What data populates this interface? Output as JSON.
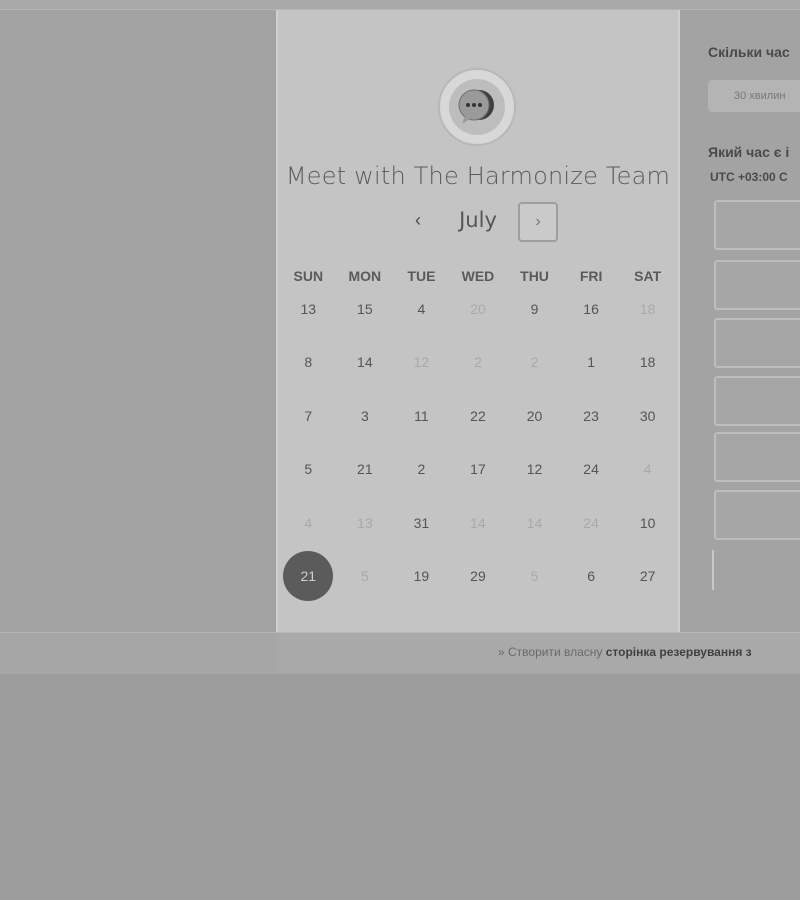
{
  "card": {
    "title": "Meet with The Harmonize Team",
    "month": "July",
    "prev_label": "‹",
    "next_label": "›"
  },
  "weekdays": [
    "SUN",
    "MON",
    "TUE",
    "WED",
    "THU",
    "FRI",
    "SAT"
  ],
  "calendar": {
    "rows": [
      [
        {
          "d": "13"
        },
        {
          "d": "15"
        },
        {
          "d": "4"
        },
        {
          "d": "20",
          "muted": true
        },
        {
          "d": "9"
        },
        {
          "d": "16"
        },
        {
          "d": "18",
          "muted": true
        }
      ],
      [
        {
          "d": "8"
        },
        {
          "d": "14"
        },
        {
          "d": "12",
          "muted": true
        },
        {
          "d": "2",
          "muted": true
        },
        {
          "d": "2",
          "muted": true
        },
        {
          "d": "1"
        },
        {
          "d": "18"
        }
      ],
      [
        {
          "d": "7"
        },
        {
          "d": "3"
        },
        {
          "d": "11"
        },
        {
          "d": "22"
        },
        {
          "d": "20"
        },
        {
          "d": "23"
        },
        {
          "d": "30"
        }
      ],
      [
        {
          "d": "5"
        },
        {
          "d": "21"
        },
        {
          "d": "2"
        },
        {
          "d": "17"
        },
        {
          "d": "12"
        },
        {
          "d": "24"
        },
        {
          "d": "4",
          "muted": true
        }
      ],
      [
        {
          "d": "4",
          "muted": true
        },
        {
          "d": "13",
          "muted": true
        },
        {
          "d": "31"
        },
        {
          "d": "14",
          "muted": true
        },
        {
          "d": "14",
          "muted": true
        },
        {
          "d": "24",
          "muted": true
        },
        {
          "d": "10"
        }
      ],
      [
        {
          "d": "21",
          "selected": true
        },
        {
          "d": "5",
          "muted": true
        },
        {
          "d": "19"
        },
        {
          "d": "29"
        },
        {
          "d": "5",
          "muted": true
        },
        {
          "d": "6"
        },
        {
          "d": "27"
        }
      ]
    ]
  },
  "right_pane": {
    "duration_heading": "Скільки час",
    "duration_chip": "30 хвилин",
    "time_heading": "Який час є і",
    "timezone": "UTC +03:00 C"
  },
  "footer": {
    "prefix": "» Створити власну ",
    "bold": "сторінка резервування з"
  }
}
